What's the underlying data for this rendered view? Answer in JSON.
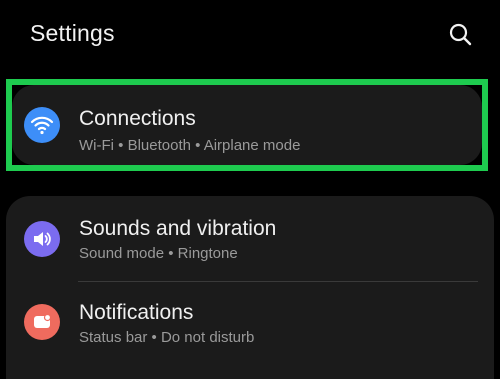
{
  "header": {
    "title": "Settings",
    "search_icon": "search-icon"
  },
  "colors": {
    "background": "#000000",
    "card": "#1b1b1b",
    "highlight": "#1ecb4f",
    "connections_icon": "#3d8ef8",
    "sounds_icon": "#7b6cf0",
    "notifications_icon": "#ef6b5e"
  },
  "items": [
    {
      "title": "Connections",
      "subtitle": "Wi-Fi  •  Bluetooth  •  Airplane mode",
      "icon": "wifi-icon",
      "highlighted": true
    },
    {
      "title": "Sounds and vibration",
      "subtitle": "Sound mode  •  Ringtone",
      "icon": "speaker-icon"
    },
    {
      "title": "Notifications",
      "subtitle": "Status bar  •  Do not disturb",
      "icon": "notification-icon"
    }
  ]
}
